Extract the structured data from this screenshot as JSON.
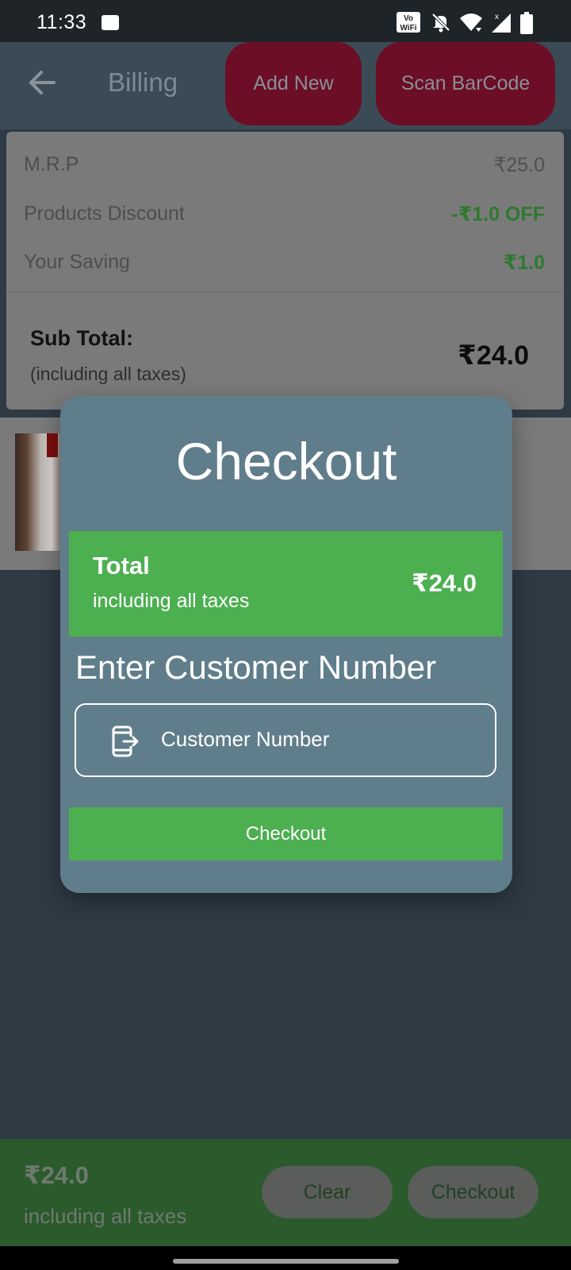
{
  "status_bar": {
    "time": "11:33",
    "wifi_label": "Vo WiFi"
  },
  "app_bar": {
    "title": "Billing",
    "add_new_label": "Add New",
    "scan_label": "Scan BarCode"
  },
  "summary": {
    "mrp_label": "M.R.P",
    "mrp_value": "₹25.0",
    "discount_label": "Products Discount",
    "discount_value": "-₹1.0 OFF",
    "saving_label": "Your Saving",
    "saving_value": "₹1.0",
    "subtotal_label": "Sub Total:",
    "subtotal_note": "(including all taxes)",
    "subtotal_value": "₹24.0"
  },
  "bottom_bar": {
    "total": "₹24.0",
    "note": "including all taxes",
    "clear_label": "Clear",
    "checkout_label": "Checkout"
  },
  "dialog": {
    "title": "Checkout",
    "total_label": "Total",
    "total_note": "including all taxes",
    "total_value": "₹24.0",
    "enter_label": "Enter Customer Number",
    "number_placeholder": "Customer Number",
    "checkout_label": "Checkout"
  },
  "colors": {
    "accent_green": "#4caf50",
    "dialog_bg": "#607d8b",
    "app_button": "#6b0e26"
  }
}
